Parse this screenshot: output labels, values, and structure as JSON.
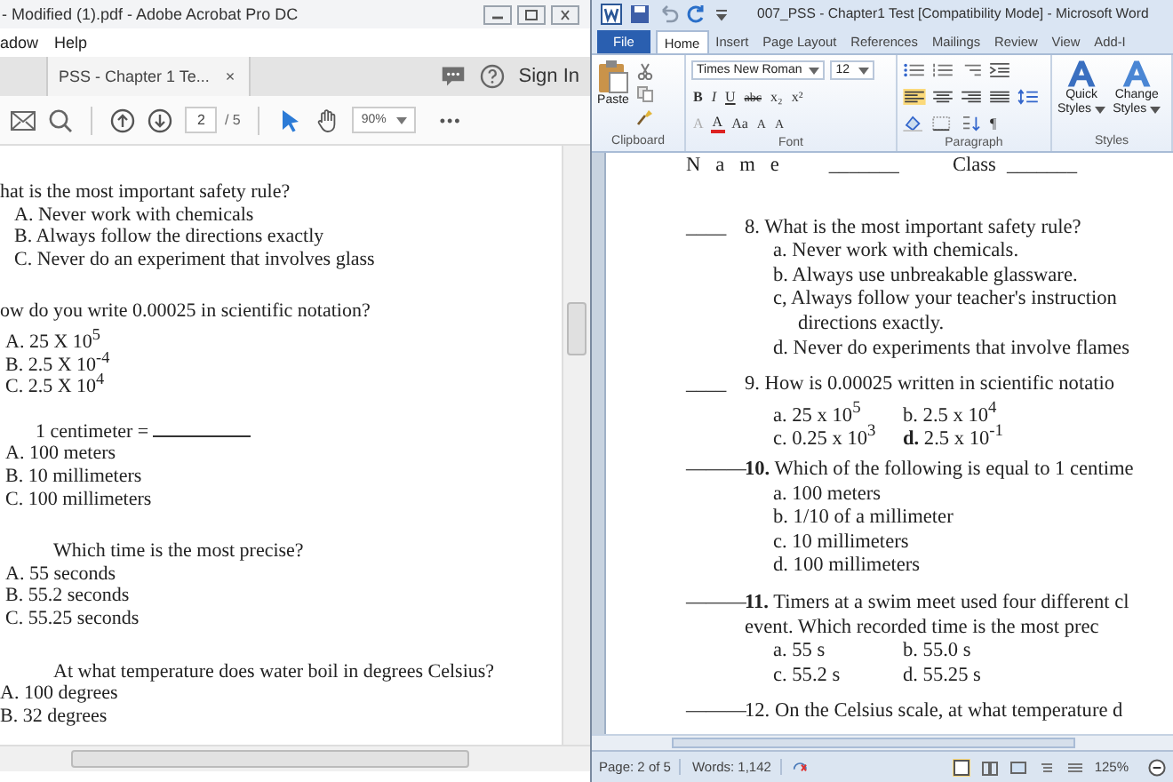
{
  "acrobat": {
    "title": "- Modified (1).pdf - Adobe Acrobat Pro DC",
    "menu": [
      "adow",
      "Help"
    ],
    "tab": {
      "label": "PSS - Chapter 1 Te...",
      "close": "×"
    },
    "sign_in": "Sign In",
    "page_number": "2",
    "page_count": "/ 5",
    "zoom": "90%",
    "more": "•••",
    "lines": [
      {
        "kind": "question",
        "text": "hat is the most important safety rule?"
      },
      {
        "kind": "option",
        "text": "A. Never work with chemicals"
      },
      {
        "kind": "option",
        "text": "B. Always follow the directions exactly"
      },
      {
        "kind": "option",
        "text": "C. Never do an experiment that involves glass"
      },
      {
        "kind": "question",
        "text": "ow do you write 0.00025 in scientific notation?"
      },
      {
        "kind": "option-flush",
        "text": "A. 25 X 10$^{5}$"
      },
      {
        "kind": "option-flush",
        "text": "B. 2.5 X 10$^{-4}$"
      },
      {
        "kind": "option-flush",
        "text": "C. 2.5 X 10$^{4}$"
      },
      {
        "kind": "question-blank",
        "text": "1 centimeter ="
      },
      {
        "kind": "option-flush",
        "text": "A. 100 meters"
      },
      {
        "kind": "option-flush",
        "text": "B. 10 millimeters"
      },
      {
        "kind": "option-flush",
        "text": "C. 100 millimeters"
      },
      {
        "kind": "question-indent",
        "text": "Which time is the most precise?"
      },
      {
        "kind": "option-flush",
        "text": "A. 55 seconds"
      },
      {
        "kind": "option-flush",
        "text": "B. 55.2 seconds"
      },
      {
        "kind": "option-flush",
        "text": "C. 55.25 seconds"
      },
      {
        "kind": "question-indent",
        "text": "At what temperature does water boil in degrees Celsius?"
      },
      {
        "kind": "option-edge",
        "text": "A. 100 degrees"
      },
      {
        "kind": "option-edge",
        "text": "B. 32 degrees"
      }
    ]
  },
  "word": {
    "title": "007_PSS - Chapter1 Test [Compatibility Mode] - Microsoft Word",
    "tabs": [
      {
        "label": "File",
        "kind": "file",
        "selected": false
      },
      {
        "label": "Home",
        "kind": "tab",
        "selected": true
      },
      {
        "label": "Insert",
        "kind": "tab",
        "selected": false
      },
      {
        "label": "Page Layout",
        "kind": "tab",
        "selected": false
      },
      {
        "label": "References",
        "kind": "tab",
        "selected": false
      },
      {
        "label": "Mailings",
        "kind": "tab",
        "selected": false
      },
      {
        "label": "Review",
        "kind": "tab",
        "selected": false
      },
      {
        "label": "View",
        "kind": "tab",
        "selected": false
      },
      {
        "label": "Add-I",
        "kind": "tab",
        "selected": false
      }
    ],
    "paste": "Paste",
    "font_name": "Times New Roman",
    "font_size": "12",
    "font_row": [
      "B",
      "I",
      "U",
      "abc",
      "x₂",
      "x²"
    ],
    "font_row2": [
      "A",
      "A",
      "Aa",
      "A",
      "A"
    ],
    "pilcrow": "¶",
    "styles": [
      {
        "top": "Quick",
        "bottom": "Styles"
      },
      {
        "top": "Change",
        "bottom": "Styles"
      }
    ],
    "groups": [
      "Clipboard",
      "Font",
      "Paragraph",
      "Styles"
    ],
    "doc": [
      {
        "kind": "header",
        "cells": [
          "N   a   m   e",
          "_______",
          "Class",
          "_______"
        ]
      },
      {
        "kind": "question",
        "blank": "____",
        "text": "8. What is the most important safety rule?"
      },
      {
        "kind": "option",
        "text": "a. Never work with chemicals."
      },
      {
        "kind": "option",
        "text": "b. Always use unbreakable glassware."
      },
      {
        "kind": "option",
        "text": "c, Always follow your teacher's instruction"
      },
      {
        "kind": "continuation",
        "text": "directions exactly."
      },
      {
        "kind": "option",
        "text": "d. Never do experiments that involve flames"
      },
      {
        "kind": "question",
        "blank": "____",
        "text": "9. How is 0.00025 written in scientific notatio"
      },
      {
        "kind": "pair",
        "cells": [
          "a. 25 x 10$^{5}$",
          "b. 2.5 x 10$^{4}$"
        ]
      },
      {
        "kind": "pair",
        "cells": [
          "c. 0.25 x 10$^{3}$",
          "**d.** 2.5 x 10$^{-1}$"
        ]
      },
      {
        "kind": "question",
        "blank": "———",
        "text": "**10.** Which of the following is equal to 1 centime"
      },
      {
        "kind": "option",
        "text": "a. 100 meters"
      },
      {
        "kind": "option",
        "text": "b. 1/10 of a millimeter"
      },
      {
        "kind": "option",
        "text": "c. 10 millimeters"
      },
      {
        "kind": "option",
        "text": "d. 100 millimeters"
      },
      {
        "kind": "question",
        "blank": "———",
        "text": "**11.** Timers at a swim meet used four different cl"
      },
      {
        "kind": "continuation-q",
        "text": "event. Which recorded time is the most prec"
      },
      {
        "kind": "pair",
        "cells": [
          "a. 55 s",
          "b. 55.0 s"
        ]
      },
      {
        "kind": "pair",
        "cells": [
          "c. 55.2 s",
          "d. 55.25 s"
        ]
      },
      {
        "kind": "question",
        "blank": "———",
        "text": "12. On the Celsius scale, at what temperature d"
      }
    ],
    "status": {
      "page": "Page: 2 of 5",
      "words": "Words: 1,142",
      "zoom": "125%"
    }
  }
}
